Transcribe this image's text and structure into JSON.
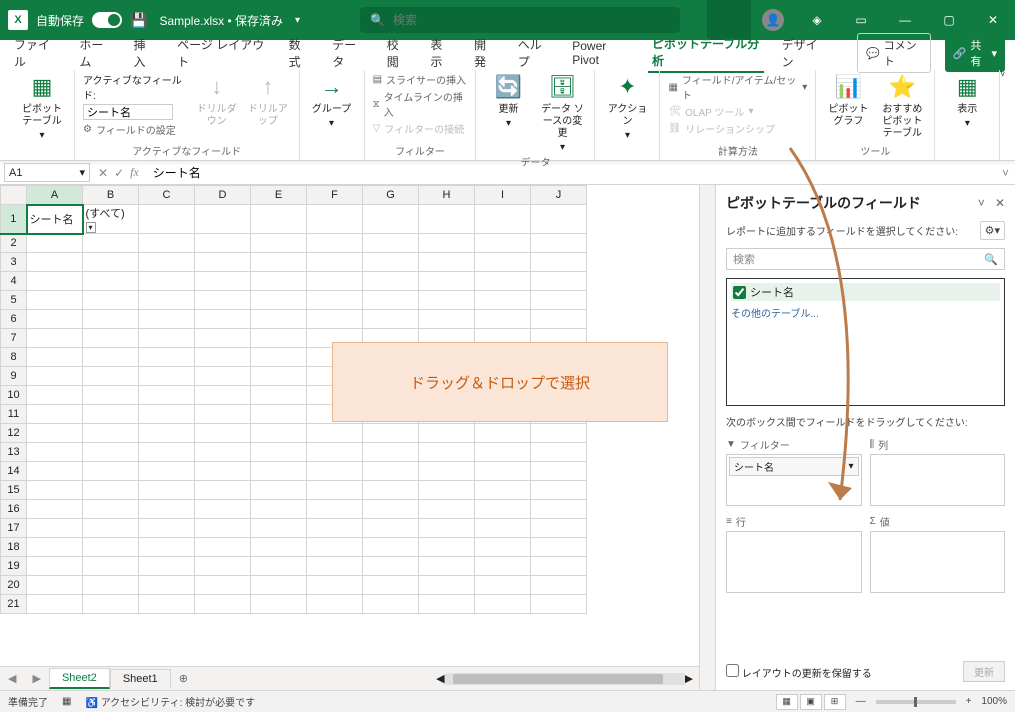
{
  "titlebar": {
    "autosave_label": "自動保存",
    "autosave_state": "オン",
    "filename": "Sample.xlsx • 保存済み",
    "search_placeholder": "検索"
  },
  "tabs": {
    "file": "ファイル",
    "home": "ホーム",
    "insert": "挿入",
    "page_layout": "ページ レイアウト",
    "formulas": "数式",
    "data": "データ",
    "review": "校閲",
    "view": "表示",
    "developer": "開発",
    "help": "ヘルプ",
    "power_pivot": "Power Pivot",
    "pivot_analyze": "ピボットテーブル分析",
    "design": "デザイン",
    "comment_btn": "コメント",
    "share_btn": "共有"
  },
  "ribbon": {
    "pivot_table_btn": "ピボットテーブル",
    "active_field_label": "アクティブなフィールド:",
    "active_field_value": "シート名",
    "field_settings": "フィールドの設定",
    "drill_down": "ドリルダウン",
    "drill_up": "ドリルアップ",
    "group_active": "アクティブなフィールド",
    "group_btn": "グループ",
    "insert_slicer": "スライサーの挿入",
    "insert_timeline": "タイムラインの挿入",
    "filter_connections": "フィルターの接続",
    "group_filter": "フィルター",
    "refresh": "更新",
    "change_data_source": "データ ソースの変更",
    "group_data": "データ",
    "actions": "アクション",
    "fields_items_sets": "フィールド/アイテム/セット",
    "olap_tools": "OLAP ツール",
    "relationships": "リレーションシップ",
    "group_calc": "計算方法",
    "pivot_chart": "ピボットグラフ",
    "recommended_pivot": "おすすめピボットテーブル",
    "display": "表示",
    "group_tools": "ツール"
  },
  "formula_bar": {
    "name_box": "A1",
    "value": "シート名"
  },
  "grid": {
    "columns": [
      "A",
      "B",
      "C",
      "D",
      "E",
      "F",
      "G",
      "H",
      "I",
      "J"
    ],
    "rows": 21,
    "A1": "シート名",
    "B1": "(すべて)"
  },
  "callout": "ドラッグ＆ドロップで選択",
  "sheets": {
    "sheet2": "Sheet2",
    "sheet1": "Sheet1"
  },
  "pane": {
    "title": "ピボットテーブルのフィールド",
    "subtitle": "レポートに追加するフィールドを選択してください:",
    "search_placeholder": "検索",
    "field1": "シート名",
    "other_tables": "その他のテーブル...",
    "drag_instruction": "次のボックス間でフィールドをドラッグしてください:",
    "filters_label": "フィルター",
    "columns_label": "列",
    "rows_label": "行",
    "values_label": "値",
    "filter_chip": "シート名",
    "defer_label": "レイアウトの更新を保留する",
    "update_btn": "更新"
  },
  "status": {
    "ready": "準備完了",
    "accessibility": "アクセシビリティ: 検討が必要です",
    "zoom": "100%"
  }
}
